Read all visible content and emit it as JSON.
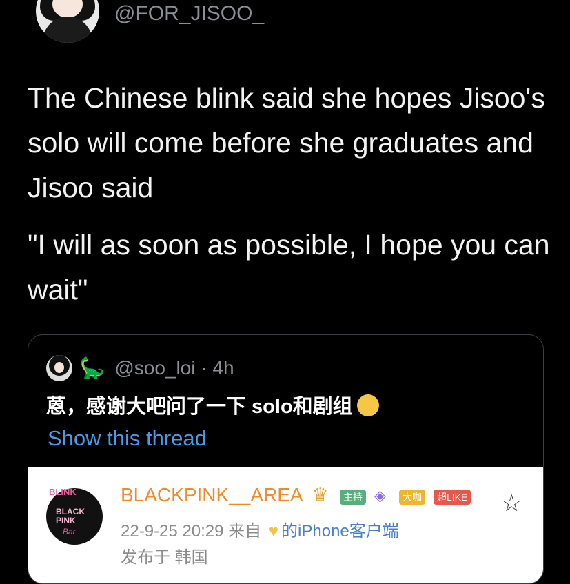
{
  "tweet": {
    "handle": "@FOR_JISOO_",
    "text_lines": [
      "The Chinese blink said she hopes Jisoo's solo will come before she graduates and Jisoo said",
      "\"I will as soon as possible, I hope you can wait\""
    ]
  },
  "quoted_tweet": {
    "handle": "@soo_loi",
    "time": "4h",
    "text": "蒽，感谢大吧问了一下 solo和剧组",
    "show_thread": "Show this thread"
  },
  "weibo_card": {
    "logo_lines": [
      "BLINK",
      "BLACK PINK",
      "Bar"
    ],
    "username": "BLACKPINK__AREA",
    "badges": [
      "主持",
      "大咖",
      "超LIKE"
    ],
    "badge_colors": [
      "#56b07a",
      "#f0b62b",
      "#e9574b"
    ],
    "date": "22-9-25 20:29",
    "from_label": "来自",
    "device": "的iPhone客户端",
    "location": "发布于 韩国"
  }
}
